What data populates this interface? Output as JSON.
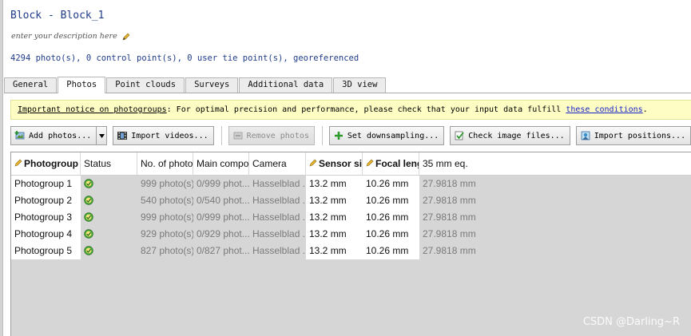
{
  "header": {
    "title": "Block - Block_1",
    "description_placeholder": "enter your description here",
    "summary": "4294 photo(s), 0 control point(s), 0 user tie point(s), georeferenced"
  },
  "tabs": [
    {
      "label": "General",
      "active": false
    },
    {
      "label": "Photos",
      "active": true
    },
    {
      "label": "Point clouds",
      "active": false
    },
    {
      "label": "Surveys",
      "active": false
    },
    {
      "label": "Additional data",
      "active": false
    },
    {
      "label": "3D view",
      "active": false
    }
  ],
  "notice": {
    "title": "Important notice on photogroups",
    "text": ": For optimal precision and performance, please check that your input data fulfill ",
    "link": "these conditions",
    "end": "."
  },
  "toolbar": {
    "add_photos": "Add photos...",
    "import_videos": "Import videos...",
    "remove_photos": "Remove photos",
    "set_downsampling": "Set downsampling...",
    "check_image_files": "Check image files...",
    "import_positions": "Import positions..."
  },
  "table": {
    "columns": [
      "Photogroup",
      "Status",
      "No. of photo",
      "Main compor",
      "Camera",
      "Sensor size",
      "Focal leng",
      "35 mm eq."
    ],
    "rows": [
      [
        "Photogroup 1",
        "",
        "999 photo(s)",
        "0/999 phot...",
        "Hasselblad ...",
        "13.2 mm",
        "10.26 mm",
        "27.9818 mm"
      ],
      [
        "Photogroup 2",
        "",
        "540 photo(s)",
        "0/540 phot...",
        "Hasselblad ...",
        "13.2 mm",
        "10.26 mm",
        "27.9818 mm"
      ],
      [
        "Photogroup 3",
        "",
        "999 photo(s)",
        "0/999 phot...",
        "Hasselblad ...",
        "13.2 mm",
        "10.26 mm",
        "27.9818 mm"
      ],
      [
        "Photogroup 4",
        "",
        "929 photo(s)",
        "0/929 phot...",
        "Hasselblad ...",
        "13.2 mm",
        "10.26 mm",
        "27.9818 mm"
      ],
      [
        "Photogroup 5",
        "",
        "827 photo(s)",
        "0/827 phot...",
        "Hasselblad ...",
        "13.2 mm",
        "10.26 mm",
        "27.9818 mm"
      ]
    ]
  },
  "icons": {
    "description_edit": "pencil-icon",
    "status": "check-circle-icon",
    "add_photos": "add-photos-icon",
    "import_videos": "film-icon",
    "remove_photos": "remove-icon",
    "set_downsampling": "plus-icon",
    "check_image_files": "check-files-icon",
    "import_positions": "import-icon"
  },
  "colors": {
    "title_blue": "#1f3c8a",
    "notice_bg": "#fdfdc4",
    "link_blue": "#1a24c8",
    "status_green": "#4caf3a"
  },
  "watermark": "CSDN @Darling~R"
}
